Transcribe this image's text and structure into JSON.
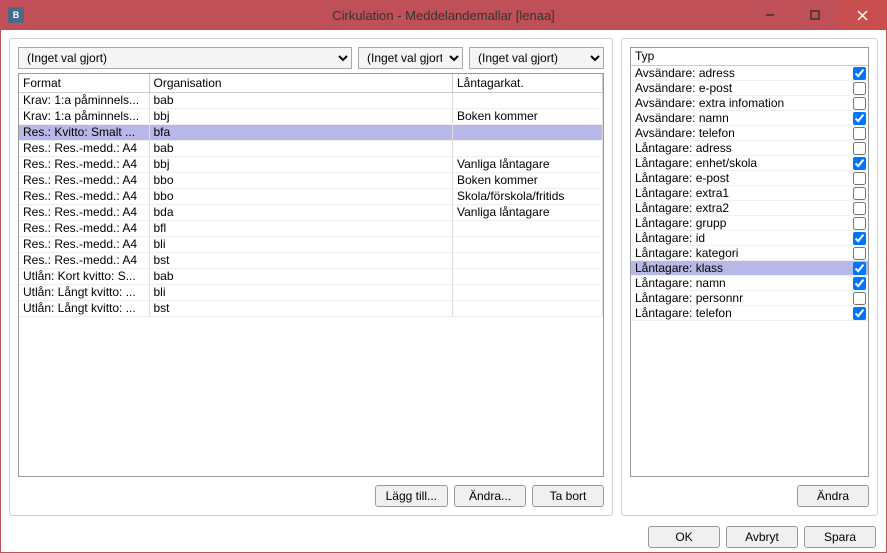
{
  "window": {
    "title": "Cirkulation - Meddelandemallar [lenaa]",
    "icon_label": "B"
  },
  "filters": {
    "opt1": "(Inget val gjort)",
    "opt2": "(Inget val gjort)",
    "opt3": "(Inget val gjort)"
  },
  "columns": {
    "format": "Format",
    "org": "Organisation",
    "lant": "Låntagarkat."
  },
  "rows": [
    {
      "format": "Krav: 1:a påminnels...",
      "org": "bab",
      "lant": ""
    },
    {
      "format": "Krav: 1:a påminnels...",
      "org": "bbj",
      "lant": "Boken kommer"
    },
    {
      "format": "Res.: Kvitto: Smalt ...",
      "org": "bfa",
      "lant": "",
      "selected": true
    },
    {
      "format": "Res.: Res.-medd.: A4",
      "org": "bab",
      "lant": ""
    },
    {
      "format": "Res.: Res.-medd.: A4",
      "org": "bbj",
      "lant": "Vanliga låntagare"
    },
    {
      "format": "Res.: Res.-medd.: A4",
      "org": "bbo",
      "lant": "Boken kommer"
    },
    {
      "format": "Res.: Res.-medd.: A4",
      "org": "bbo",
      "lant": "Skola/förskola/fritids"
    },
    {
      "format": "Res.: Res.-medd.: A4",
      "org": "bda",
      "lant": "Vanliga låntagare"
    },
    {
      "format": "Res.: Res.-medd.: A4",
      "org": "bfl",
      "lant": ""
    },
    {
      "format": "Res.: Res.-medd.: A4",
      "org": "bli",
      "lant": ""
    },
    {
      "format": "Res.: Res.-medd.: A4",
      "org": "bst",
      "lant": ""
    },
    {
      "format": "Utlån: Kort kvitto: S...",
      "org": "bab",
      "lant": ""
    },
    {
      "format": "Utlån: Långt kvitto: ...",
      "org": "bli",
      "lant": ""
    },
    {
      "format": "Utlån: Långt kvitto: ...",
      "org": "bst",
      "lant": ""
    }
  ],
  "typ": {
    "header": "Typ",
    "items": [
      {
        "label": "Avsändare: adress",
        "checked": true
      },
      {
        "label": "Avsändare: e-post",
        "checked": false
      },
      {
        "label": "Avsändare: extra infomation",
        "checked": false
      },
      {
        "label": "Avsändare: namn",
        "checked": true
      },
      {
        "label": "Avsändare: telefon",
        "checked": false
      },
      {
        "label": "Låntagare: adress",
        "checked": false
      },
      {
        "label": "Låntagare: enhet/skola",
        "checked": true
      },
      {
        "label": "Låntagare: e-post",
        "checked": false
      },
      {
        "label": "Låntagare: extra1",
        "checked": false
      },
      {
        "label": "Låntagare: extra2",
        "checked": false
      },
      {
        "label": "Låntagare: grupp",
        "checked": false
      },
      {
        "label": "Låntagare: id",
        "checked": true
      },
      {
        "label": "Låntagare: kategori",
        "checked": false
      },
      {
        "label": "Låntagare: klass",
        "checked": true,
        "selected": true
      },
      {
        "label": "Låntagare: namn",
        "checked": true
      },
      {
        "label": "Låntagare: personnr",
        "checked": false
      },
      {
        "label": "Låntagare: telefon",
        "checked": true
      }
    ]
  },
  "buttons": {
    "add": "Lägg till...",
    "edit": "Ändra...",
    "del": "Ta bort",
    "edit2": "Ändra",
    "ok": "OK",
    "cancel": "Avbryt",
    "save": "Spara"
  }
}
